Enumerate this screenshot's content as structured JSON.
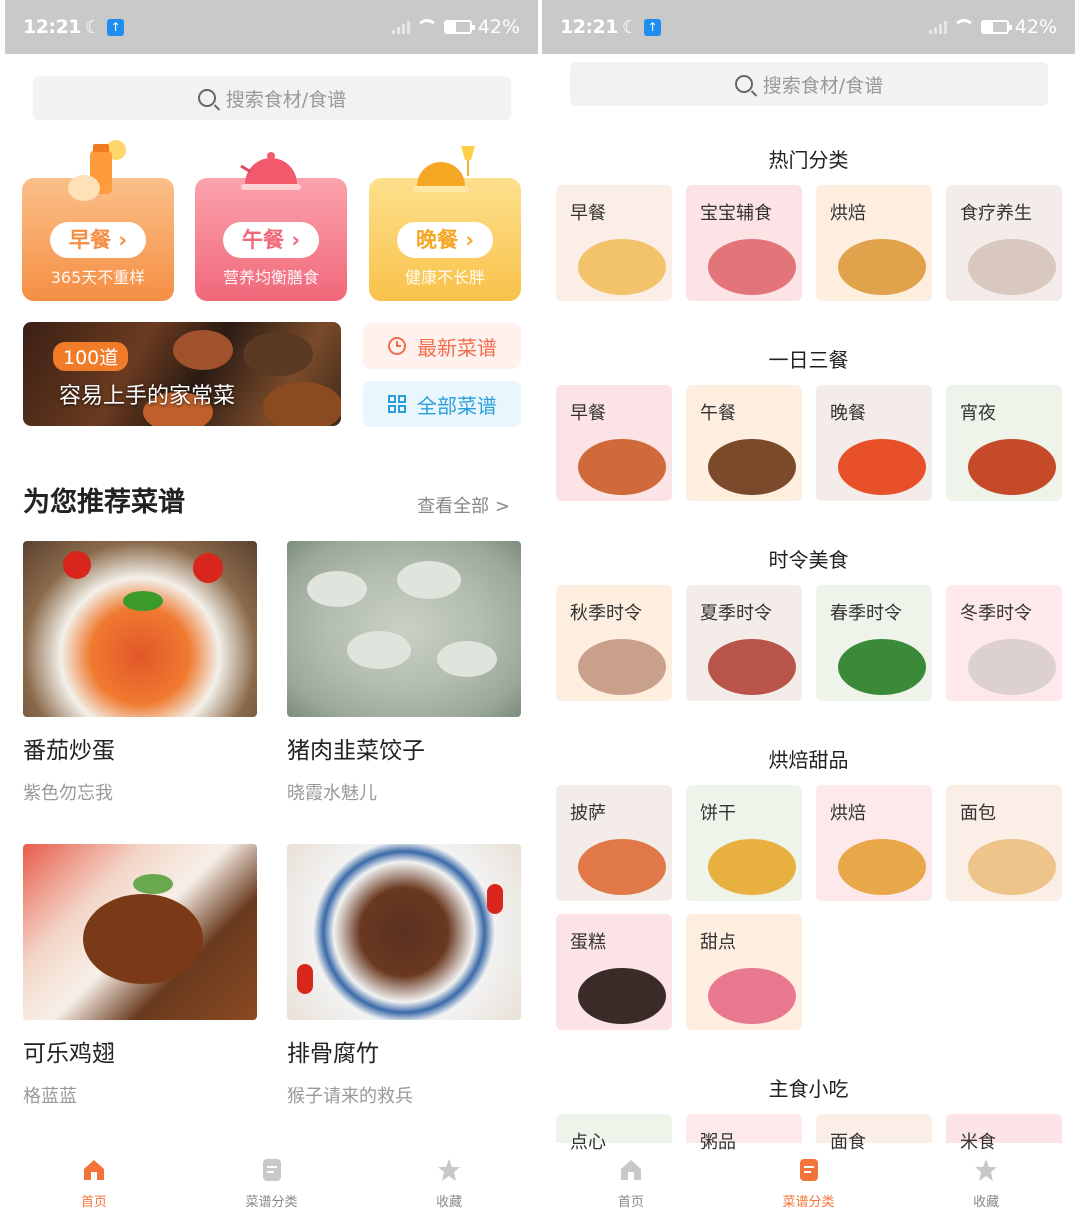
{
  "left": {
    "status": {
      "time": "12:21",
      "battery": "42%"
    },
    "search": {
      "placeholder": "搜索食材/食谱"
    },
    "meals": [
      {
        "title": "早餐",
        "subtitle": "365天不重样"
      },
      {
        "title": "午餐",
        "subtitle": "营养均衡膳食"
      },
      {
        "title": "晚餐",
        "subtitle": "健康不长胖"
      }
    ],
    "banner": {
      "tag": "100道",
      "title": "容易上手的家常菜"
    },
    "quick_links": {
      "newest": "最新菜谱",
      "all": "全部菜谱"
    },
    "recommend": {
      "title": "为您推荐菜谱",
      "see_all": "查看全部 >",
      "recipes": [
        {
          "name": "番茄炒蛋",
          "author": "紫色勿忘我"
        },
        {
          "name": "猪肉韭菜饺子",
          "author": "晓霞水魅儿"
        },
        {
          "name": "可乐鸡翅",
          "author": "格蓝蓝"
        },
        {
          "name": "排骨腐竹",
          "author": "猴子请来的救兵"
        }
      ]
    },
    "tabbar": [
      "首页",
      "菜谱分类",
      "收藏"
    ]
  },
  "right": {
    "status": {
      "time": "12:21",
      "battery": "42%"
    },
    "search": {
      "placeholder": "搜索食材/食谱"
    },
    "sections": [
      {
        "title": "热门分类",
        "items": [
          "早餐",
          "宝宝辅食",
          "烘焙",
          "食疗养生"
        ]
      },
      {
        "title": "一日三餐",
        "items": [
          "早餐",
          "午餐",
          "晚餐",
          "宵夜"
        ]
      },
      {
        "title": "时令美食",
        "items": [
          "秋季时令",
          "夏季时令",
          "春季时令",
          "冬季时令"
        ]
      },
      {
        "title": "烘焙甜品",
        "items": [
          "披萨",
          "饼干",
          "烘焙",
          "面包",
          "蛋糕",
          "甜点"
        ]
      },
      {
        "title": "主食小吃",
        "items": [
          "点心",
          "粥品",
          "面食",
          "米食"
        ]
      }
    ],
    "tabbar": [
      "首页",
      "菜谱分类",
      "收藏"
    ]
  },
  "colors": {
    "accent": "#f3743a",
    "breakfast": "#f7a25c",
    "lunch": "#f0687a",
    "dinner": "#f8c24a",
    "quick_new": "#f06e4e",
    "quick_all": "#2c9fd9"
  }
}
